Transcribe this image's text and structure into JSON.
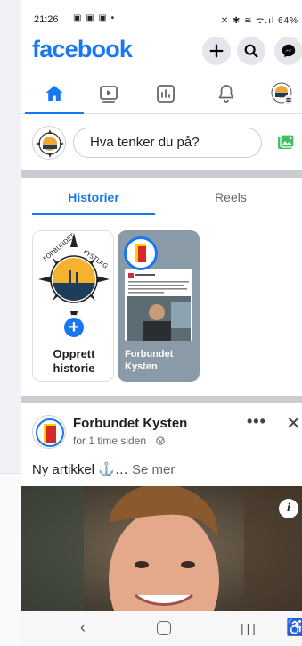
{
  "status_bar": {
    "time": "21:26",
    "notification_icons": "▣ ▣ ▣ •",
    "system_icons": "✕ ✱ ≋ ᯤ.ıl",
    "battery": "64%"
  },
  "header": {
    "logo": "facebook"
  },
  "composer": {
    "placeholder": "Hva tenker du på?"
  },
  "tabs": [
    {
      "label": "Historier",
      "active": true
    },
    {
      "label": "Reels",
      "active": false
    }
  ],
  "stories": {
    "create_label_line1": "Opprett",
    "create_label_line2": "historie",
    "card_name_line1": "Forbundet",
    "card_name_line2": "Kysten"
  },
  "post": {
    "author": "Forbundet Kysten",
    "time": "for 1 time siden · ",
    "text": "Ny artikkel ⚓…",
    "see_more": " Se mer",
    "more_icon": "•••",
    "close_icon": "✕"
  },
  "colors": {
    "brand": "#1877f2",
    "text": "#1c1e21",
    "muted": "#65676b"
  }
}
